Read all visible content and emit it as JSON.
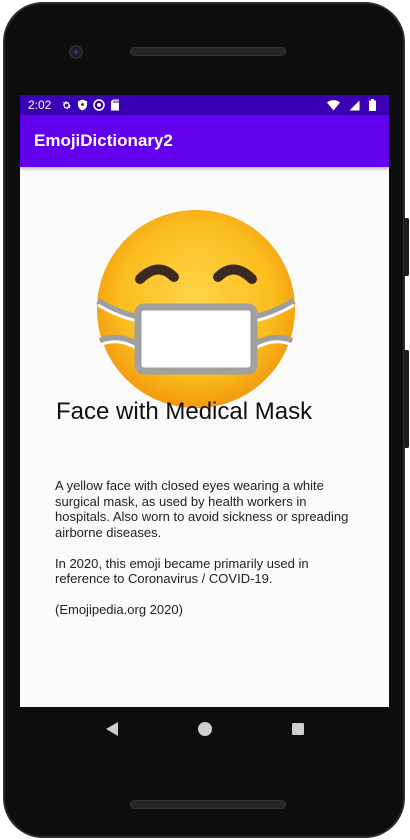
{
  "status_bar": {
    "time": "2:02",
    "left_icons": [
      "settings-icon",
      "shield-icon",
      "sync-icon",
      "sd-card-icon"
    ],
    "right_icons": [
      "wifi-icon",
      "signal-icon",
      "battery-icon"
    ]
  },
  "app_bar": {
    "title": "EmojiDictionary2"
  },
  "emoji": {
    "name": "Face with Medical Mask",
    "image_icon": "face-with-medical-mask-icon",
    "paragraphs": [
      "A yellow face with closed eyes wearing a white surgical mask, as used by health workers in hospitals. Also worn to avoid sickness or spreading airborne diseases.",
      "In 2020, this emoji became primarily used in reference to Coronavirus / COVID-19.",
      "(Emojipedia.org 2020)"
    ]
  },
  "nav_bar": {
    "buttons": [
      "back-icon",
      "home-icon",
      "recents-icon"
    ]
  },
  "colors": {
    "status_bar": "#3b00b3",
    "app_bar": "#6200ee",
    "screen_bg": "#fafafa",
    "emoji_yellow": "#ffc61b"
  }
}
